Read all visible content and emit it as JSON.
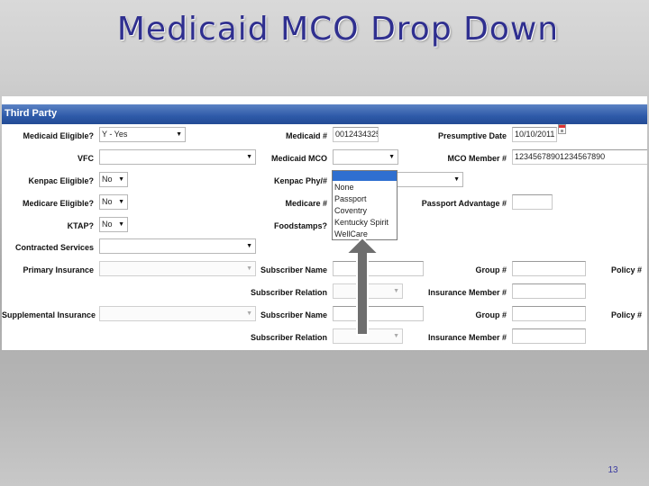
{
  "slide": {
    "title": "Medicaid MCO Drop Down",
    "page_number": "13"
  },
  "form": {
    "section_title": "Third Party",
    "medicaid_eligible": {
      "label": "Medicaid Eligible?",
      "value": "Y - Yes"
    },
    "medicaid_number": {
      "label": "Medicaid #",
      "value": "0012434325"
    },
    "presumptive_date": {
      "label": "Presumptive Date",
      "value": "10/10/2011",
      "icon": "calendar-icon"
    },
    "vfc": {
      "label": "VFC",
      "value": ""
    },
    "medicaid_mco": {
      "label": "Medicaid MCO",
      "value": "",
      "options": [
        "",
        "None",
        "Passport",
        "Coventry",
        "Kentucky Spirit",
        "WellCare"
      ],
      "highlighted_index": 0
    },
    "mco_member_number": {
      "label": "MCO Member #",
      "value": "12345678901234567890"
    },
    "kenpac_eligible": {
      "label": "Kenpac Eligible?",
      "value": "No"
    },
    "kenpac_phy": {
      "label": "Kenpac Phy/#",
      "value": ""
    },
    "medicare_eligible": {
      "label": "Medicare Eligible?",
      "value": "No"
    },
    "medicare_number": {
      "label": "Medicare #",
      "value": ""
    },
    "passport_advantage": {
      "label": "Passport Advantage #",
      "value": ""
    },
    "ktap": {
      "label": "KTAP?",
      "value": "No"
    },
    "foodstamps": {
      "label": "Foodstamps?",
      "value": ""
    },
    "contracted_services": {
      "label": "Contracted Services",
      "value": ""
    },
    "primary_insurance": {
      "label": "Primary Insurance",
      "value": ""
    },
    "subscriber_name_1": {
      "label": "Subscriber Name",
      "value": ""
    },
    "group_1": {
      "label": "Group #",
      "value": ""
    },
    "policy_1": {
      "label": "Policy #",
      "value": ""
    },
    "subscriber_relation_1": {
      "label": "Subscriber Relation",
      "value": ""
    },
    "insurance_member_1": {
      "label": "Insurance Member #",
      "value": ""
    },
    "supplemental_insurance": {
      "label": "Supplemental Insurance",
      "value": ""
    },
    "subscriber_name_2": {
      "label": "Subscriber Name",
      "value": ""
    },
    "group_2": {
      "label": "Group #",
      "value": ""
    },
    "policy_2": {
      "label": "Policy #",
      "value": ""
    },
    "subscriber_relation_2": {
      "label": "Subscriber Relation",
      "value": ""
    },
    "insurance_member_2": {
      "label": "Insurance Member #",
      "value": ""
    }
  },
  "colors": {
    "title": "#2f2f8f",
    "header_bar": "#2e5aa8",
    "selection_highlight": "#2f6fd0",
    "annotation_arrow": "#6e6e6e"
  }
}
